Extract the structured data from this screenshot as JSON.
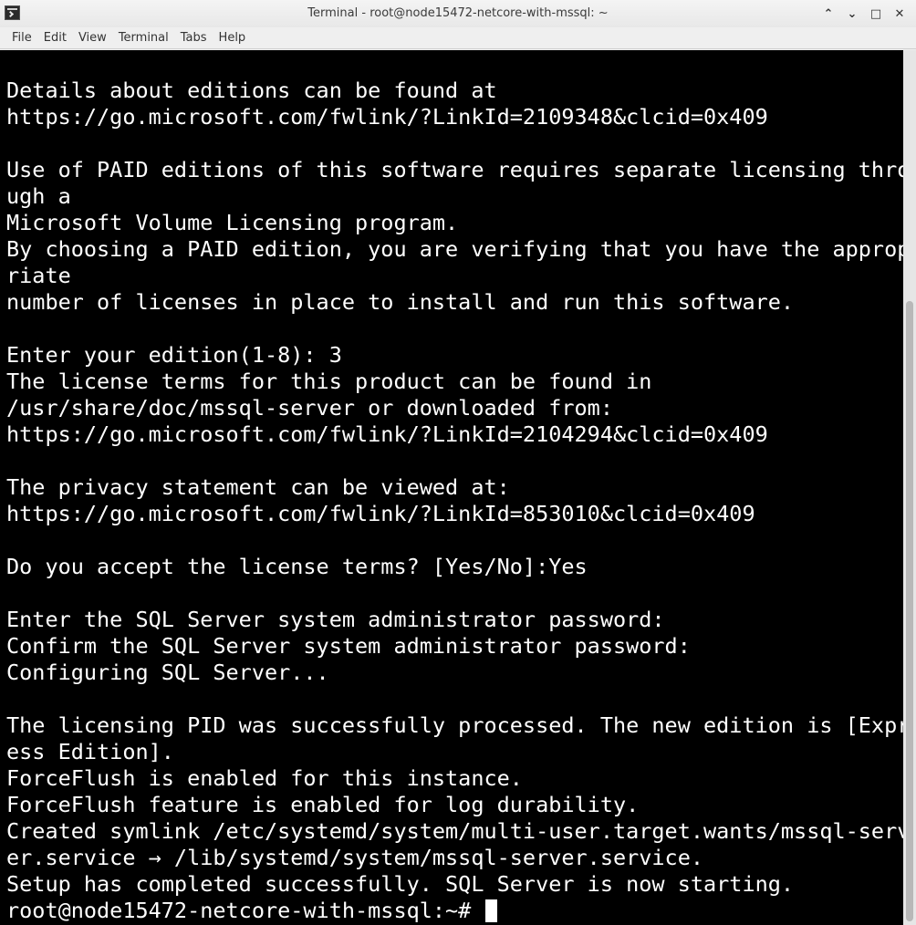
{
  "window": {
    "title": "Terminal - root@node15472-netcore-with-mssql: ~",
    "controls": {
      "minimize": "⌃",
      "maximize_down": "⌄",
      "restore": "□",
      "close": "✕"
    }
  },
  "menu": {
    "items": [
      "File",
      "Edit",
      "View",
      "Terminal",
      "Tabs",
      "Help"
    ]
  },
  "terminal": {
    "lines": [
      "Details about editions can be found at",
      "https://go.microsoft.com/fwlink/?LinkId=2109348&clcid=0x409",
      "",
      "Use of PAID editions of this software requires separate licensing thro",
      "ugh a",
      "Microsoft Volume Licensing program.",
      "By choosing a PAID edition, you are verifying that you have the approp",
      "riate",
      "number of licenses in place to install and run this software.",
      "",
      "Enter your edition(1-8): 3",
      "The license terms for this product can be found in",
      "/usr/share/doc/mssql-server or downloaded from:",
      "https://go.microsoft.com/fwlink/?LinkId=2104294&clcid=0x409",
      "",
      "The privacy statement can be viewed at:",
      "https://go.microsoft.com/fwlink/?LinkId=853010&clcid=0x409",
      "",
      "Do you accept the license terms? [Yes/No]:Yes",
      "",
      "Enter the SQL Server system administrator password:",
      "Confirm the SQL Server system administrator password:",
      "Configuring SQL Server...",
      "",
      "The licensing PID was successfully processed. The new edition is [Expr",
      "ess Edition].",
      "ForceFlush is enabled for this instance.",
      "ForceFlush feature is enabled for log durability.",
      "Created symlink /etc/systemd/system/multi-user.target.wants/mssql-serv",
      "er.service → /lib/systemd/system/mssql-server.service.",
      "Setup has completed successfully. SQL Server is now starting."
    ],
    "prompt": "root@node15472-netcore-with-mssql:~# "
  }
}
